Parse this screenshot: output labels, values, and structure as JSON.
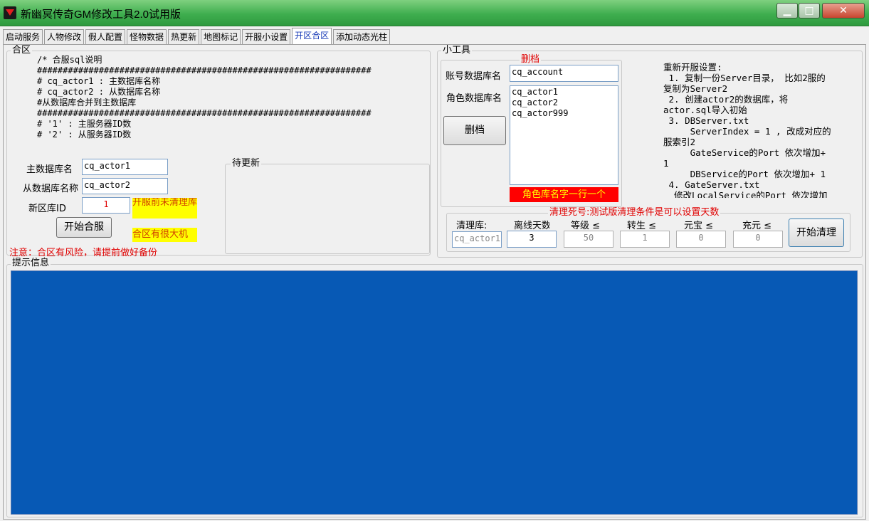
{
  "window": {
    "title": "新幽冥传奇GM修改工具2.0试用版",
    "minimize": "▁",
    "maximize": "□",
    "close": "✕"
  },
  "tabs": [
    "启动服务",
    "人物修改",
    "假人配置",
    "怪物数据",
    "热更新",
    "地图标记",
    "开服小设置",
    "开区合区",
    "添加动态光柱"
  ],
  "active_tab": "开区合区",
  "merge": {
    "group_title": "合区",
    "sql_lines": [
      "/* 合服sql说明",
      "#################################################################",
      "",
      "# cq_actor1 : 主数据库名称",
      "# cq_actor2 : 从数据库名称",
      "#从数据库合并到主数据库",
      "#################################################################",
      "",
      "# '1' : 主服务器ID数",
      "# '2' : 从服务器ID数"
    ],
    "main_db_label": "主数据库名",
    "main_db_value": "cq_actor1",
    "slave_db_label": "从数据库名称",
    "slave_db_value": "cq_actor2",
    "new_zone_label": "新区库ID",
    "new_zone_value": "1",
    "start_button": "开始合服",
    "warn_clean": "开服前未清理库",
    "warn_risk": "合区有很大机",
    "notice": "注意：合区有风险，请提前做好备份"
  },
  "pending": {
    "group_title": "待更新"
  },
  "tools": {
    "group_title": "小工具",
    "delete_group_title": "删档",
    "account_db_label": "账号数据库名",
    "account_db_value": "cq_account",
    "role_db_label": "角色数据库名",
    "role_db_list": [
      "cq_actor1",
      "cq_actor2",
      "cq_actor999"
    ],
    "delete_button": "删档",
    "role_db_hint": "角色库名字一行一个",
    "reopen_lines": [
      "重新开服设置:",
      " 1. 复制一份Server目录， 比如2服的",
      "复制为Server2",
      " 2. 创建actor2的数据库，将",
      "actor.sql导入初始",
      " 3. DBServer.txt",
      "     ServerIndex = 1 , 改成对应的",
      "服索引2",
      "     GateService的Port 依次增加+",
      "1",
      "     DBService的Port 依次增加+ 1",
      " 4. GateServer.txt",
      "  修改LocalService的Port 依次增加"
    ],
    "clean_title": "清理死号:测试版清理条件是可以设置天数",
    "clean_db_label": "清理库:",
    "clean_db_value": "cq_actor1",
    "col_offline": "离线天数",
    "col_level": "等级 ≤",
    "col_rebirth": "转生 ≤",
    "col_yuanbao": "元宝 ≤",
    "col_recharge": "充元 ≤",
    "val_offline": "3",
    "val_level": "50",
    "val_rebirth": "1",
    "val_yuanbao": "0",
    "val_recharge": "0",
    "clean_button": "开始清理"
  },
  "info": {
    "group_title": "提示信息",
    "panel_color": "#0759b5"
  }
}
